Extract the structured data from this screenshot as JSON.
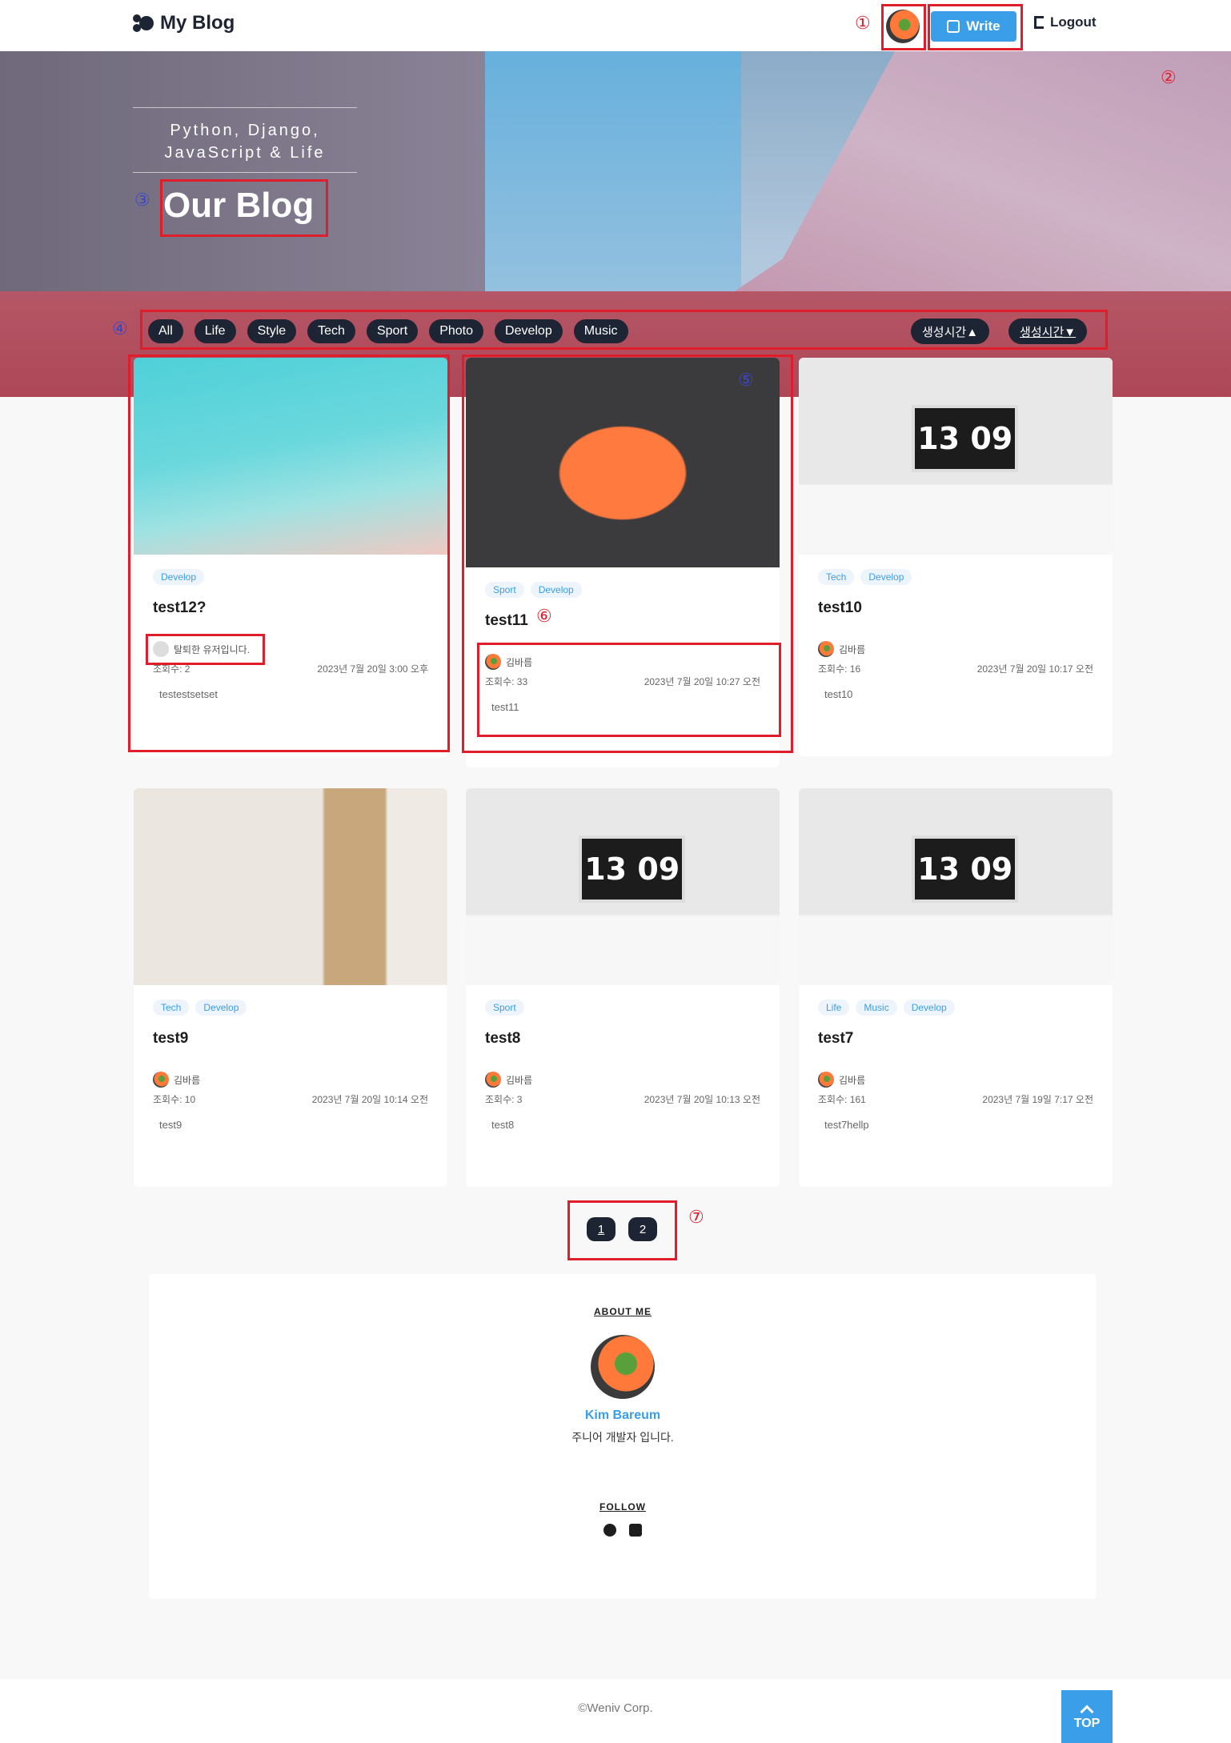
{
  "header": {
    "logo": "My Blog",
    "write_label": "Write",
    "logout_label": "Logout"
  },
  "hero": {
    "tagline_line1": "Python, Django,",
    "tagline_line2": "JavaScript & Life",
    "title": "Our Blog"
  },
  "categories": [
    "All",
    "Life",
    "Style",
    "Tech",
    "Sport",
    "Photo",
    "Develop",
    "Music"
  ],
  "sorts": [
    "생성시간▲",
    "생성시간▼"
  ],
  "posts": [
    {
      "tags": [
        "Develop"
      ],
      "title": "test12?",
      "author": "탈퇴한 유저입니다.",
      "views": "조회수: 2",
      "date": "2023년 7월 20일 3:00 오후",
      "excerpt": "testestsetset"
    },
    {
      "tags": [
        "Sport",
        "Develop"
      ],
      "title": "test11",
      "author": "김바름",
      "views": "조회수: 33",
      "date": "2023년 7월 20일 10:27 오전",
      "excerpt": "test11"
    },
    {
      "tags": [
        "Tech",
        "Develop"
      ],
      "title": "test10",
      "author": "김바름",
      "views": "조회수: 16",
      "date": "2023년 7월 20일 10:17 오전",
      "excerpt": "test10"
    },
    {
      "tags": [
        "Tech",
        "Develop"
      ],
      "title": "test9",
      "author": "김바름",
      "views": "조회수: 10",
      "date": "2023년 7월 20일 10:14 오전",
      "excerpt": "test9"
    },
    {
      "tags": [
        "Sport"
      ],
      "title": "test8",
      "author": "김바름",
      "views": "조회수: 3",
      "date": "2023년 7월 20일 10:13 오전",
      "excerpt": "test8"
    },
    {
      "tags": [
        "Life",
        "Music",
        "Develop"
      ],
      "title": "test7",
      "author": "김바름",
      "views": "조회수: 161",
      "date": "2023년 7월 19일 7:17 오전",
      "excerpt": "test7hellp"
    }
  ],
  "clock_text": "13 09",
  "pagination": [
    "1",
    "2"
  ],
  "about": {
    "heading": "ABOUT ME",
    "name": "Kim Bareum",
    "desc": "주니어 개발자 입니다.",
    "follow_heading": "FOLLOW",
    "icons": [
      "github-icon",
      "mail-icon"
    ]
  },
  "footer": {
    "copyright": "©Weniv Corp.",
    "top_label": "TOP"
  },
  "annotations": [
    "①",
    "②",
    "③",
    "④",
    "⑤",
    "⑥",
    "⑦"
  ],
  "colors": {
    "accent": "#3a9ee9",
    "dark": "#1d2433",
    "annotation": "#e01e2b"
  }
}
